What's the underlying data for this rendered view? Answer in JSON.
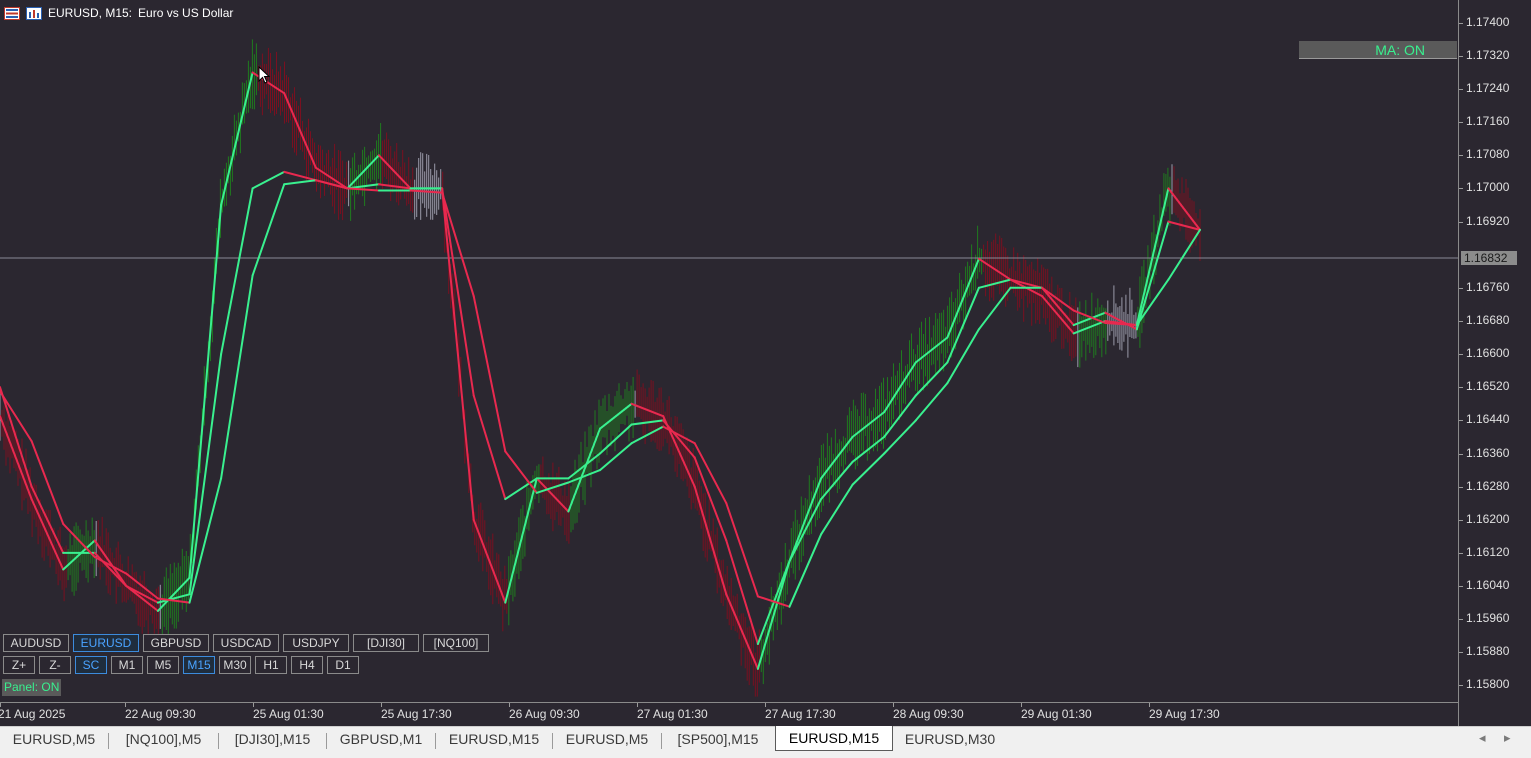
{
  "window": {
    "symbol_title": "EURUSD, M15:",
    "description": "Euro vs US Dollar"
  },
  "ma_indicator": {
    "label": "MA: ON"
  },
  "panel_indicator": {
    "label": "Panel: ON"
  },
  "symbol_buttons": [
    {
      "label": "AUDUSD",
      "active": false
    },
    {
      "label": "EURUSD",
      "active": true
    },
    {
      "label": "GBPUSD",
      "active": false
    },
    {
      "label": "USDCAD",
      "active": false
    },
    {
      "label": "USDJPY",
      "active": false
    },
    {
      "label": "[DJI30]",
      "active": false
    },
    {
      "label": "[NQ100]",
      "active": false
    }
  ],
  "timeframe_buttons": [
    {
      "label": "Z+",
      "active": false
    },
    {
      "label": "Z-",
      "active": false
    },
    {
      "label": "SC",
      "active": true
    },
    {
      "label": "M1",
      "active": false
    },
    {
      "label": "M5",
      "active": false
    },
    {
      "label": "M15",
      "active": true
    },
    {
      "label": "M30",
      "active": false
    },
    {
      "label": "H1",
      "active": false
    },
    {
      "label": "H4",
      "active": false
    },
    {
      "label": "D1",
      "active": false
    }
  ],
  "price_scale": {
    "ticks": [
      "1.17400",
      "1.17320",
      "1.17240",
      "1.17160",
      "1.17080",
      "1.17000",
      "1.16920",
      "1.16760",
      "1.16680",
      "1.16600",
      "1.16520",
      "1.16440",
      "1.16360",
      "1.16280",
      "1.16200",
      "1.16120",
      "1.16040",
      "1.15960",
      "1.15880",
      "1.15800"
    ],
    "current_price": "1.16832"
  },
  "time_scale": {
    "labels": [
      "21 Aug 2025",
      "22 Aug 09:30",
      "25 Aug 01:30",
      "25 Aug 17:30",
      "26 Aug 09:30",
      "27 Aug 01:30",
      "27 Aug 17:30",
      "28 Aug 09:30",
      "29 Aug 01:30",
      "29 Aug 17:30"
    ]
  },
  "tabs": [
    {
      "label": "EURUSD,M5",
      "active": false
    },
    {
      "label": "[NQ100],M5",
      "active": false
    },
    {
      "label": "[DJI30],M15",
      "active": false
    },
    {
      "label": "GBPUSD,M1",
      "active": false
    },
    {
      "label": "EURUSD,M15",
      "active": false
    },
    {
      "label": "EURUSD,M5",
      "active": false
    },
    {
      "label": "[SP500],M15",
      "active": false
    },
    {
      "label": "EURUSD,M15",
      "active": true
    },
    {
      "label": "EURUSD,M30",
      "active": false
    }
  ],
  "tab_nav": {
    "left": "◂",
    "right": "▸"
  },
  "colors": {
    "background": "#2b2730",
    "ma_up": "#39f08f",
    "ma_down": "#e8294f",
    "bar_up": "#1f7a1f",
    "bar_down": "#7a1020",
    "bar_neutral": "#9a9aa8",
    "accent_blue": "#4aa3ff"
  },
  "chart_data": {
    "type": "line",
    "series": [
      {
        "values": [
          1.1645,
          1.1625,
          1.1608,
          1.1615,
          1.1604,
          1.1598,
          1.1606,
          1.1696,
          1.1728,
          1.1723,
          1.1705,
          1.17,
          1.1708,
          1.17,
          1.17,
          1.162,
          1.16,
          1.163,
          1.1622,
          1.1642,
          1.1648,
          1.1645,
          1.1628,
          1.1602,
          1.1584,
          1.161,
          1.163,
          1.164,
          1.1646,
          1.1658,
          1.1664,
          1.1683,
          1.1678,
          1.1674,
          1.1665,
          1.1668,
          1.1667,
          1.17,
          1.169
        ]
      },
      {
        "values": [
          1.1652,
          1.1628,
          1.1612,
          1.1612,
          1.1604,
          1.16,
          1.1602,
          1.166,
          1.17,
          1.1704,
          1.1702,
          1.17,
          1.1701,
          1.17,
          1.17,
          1.165,
          1.1625,
          1.163,
          1.163,
          1.1636,
          1.1643,
          1.1644,
          1.1635,
          1.1615,
          1.159,
          1.161,
          1.1625,
          1.1634,
          1.164,
          1.165,
          1.1658,
          1.1676,
          1.1678,
          1.1676,
          1.1667,
          1.167,
          1.1666,
          1.1692,
          1.169
        ]
      }
    ],
    "x_labels": [
      "21 Aug 2025",
      "22 Aug 09:30",
      "25 Aug 01:30",
      "25 Aug 17:30",
      "26 Aug 09:30",
      "27 Aug 01:30",
      "27 Aug 17:30",
      "28 Aug 09:30",
      "29 Aug 01:30",
      "29 Aug 17:30"
    ],
    "ylim": [
      1.1576,
      1.17455
    ],
    "grid": false
  }
}
